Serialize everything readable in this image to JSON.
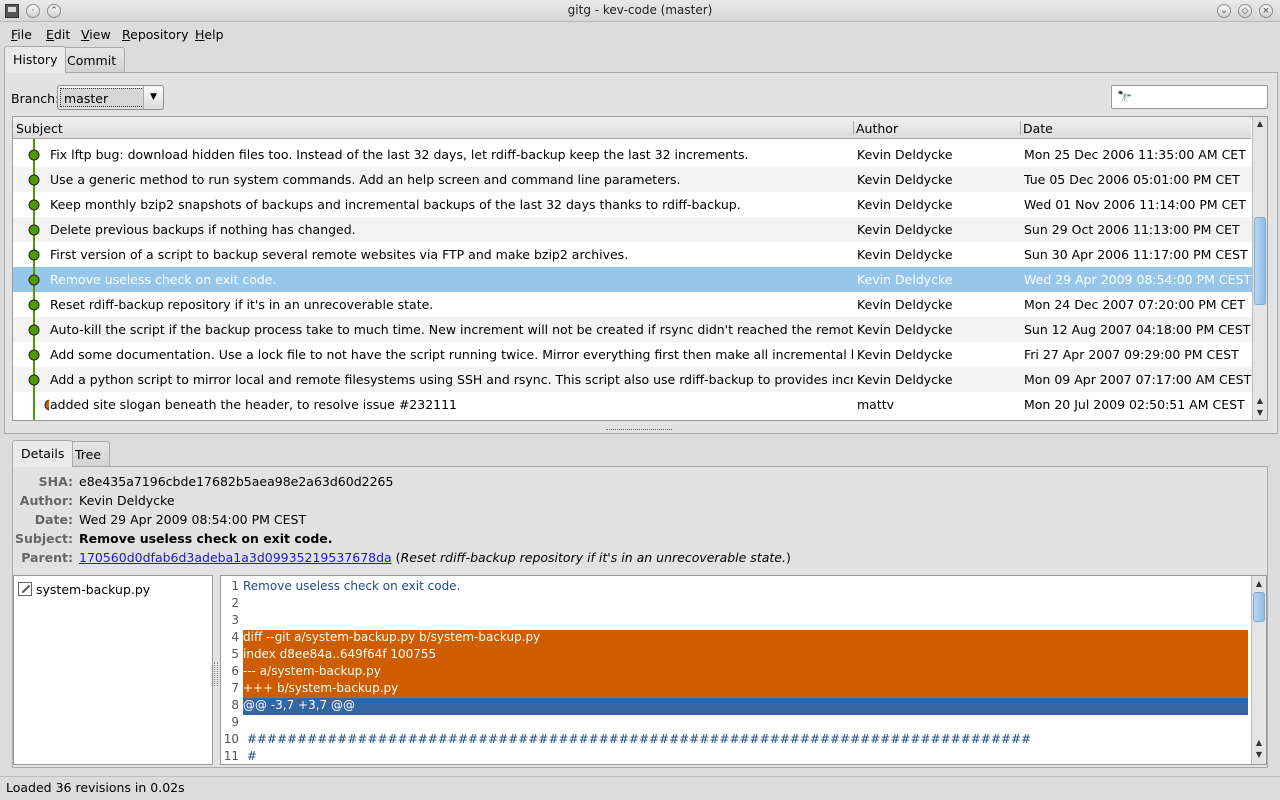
{
  "window": {
    "title": "gitg - kev-code (master)"
  },
  "menu": [
    {
      "label": "File",
      "u": "F",
      "rest": "ile"
    },
    {
      "label": "Edit",
      "u": "E",
      "rest": "dit"
    },
    {
      "label": "View",
      "u": "V",
      "rest": "iew"
    },
    {
      "label": "Repository",
      "u": "R",
      "rest": "epository"
    },
    {
      "label": "Help",
      "u": "H",
      "rest": "elp"
    }
  ],
  "tabs": {
    "history": "History",
    "commit": "Commit"
  },
  "branch": {
    "label": "Branch:",
    "value": "master"
  },
  "search": {
    "value": ""
  },
  "history": {
    "columns": {
      "subject": "Subject",
      "author": "Author",
      "date": "Date"
    },
    "rows": [
      {
        "subject": "Fix lftp bug: download hidden files too. Instead of the last 32 days, let rdiff-backup keep the last 32 increments.",
        "author": "Kevin Deldycke",
        "date": "Mon 25 Dec 2006 11:35:00 AM CET"
      },
      {
        "subject": "Use a generic method to run system commands. Add an help screen and command line parameters.",
        "author": "Kevin Deldycke",
        "date": "Tue 05 Dec 2006 05:01:00 PM CET"
      },
      {
        "subject": "Keep monthly bzip2 snapshots of backups and incremental backups of the last 32 days thanks to rdiff-backup.",
        "author": "Kevin Deldycke",
        "date": "Wed 01 Nov 2006 11:14:00 PM CET"
      },
      {
        "subject": "Delete previous backups if nothing has changed.",
        "author": "Kevin Deldycke",
        "date": "Sun 29 Oct 2006 11:13:00 PM CET"
      },
      {
        "subject": "First version of a script to backup several remote websites via FTP and make bzip2 archives.",
        "author": "Kevin Deldycke",
        "date": "Sun 30 Apr 2006 11:17:00 PM CEST"
      },
      {
        "subject": "Remove useless check on exit code.",
        "author": "Kevin Deldycke",
        "date": "Wed 29 Apr 2009 08:54:00 PM CEST"
      },
      {
        "subject": "Reset rdiff-backup repository if it's in an unrecoverable state.",
        "author": "Kevin Deldycke",
        "date": "Mon 24 Dec 2007 07:20:00 PM CET"
      },
      {
        "subject": "Auto-kill the script if the backup process take to much time. New increment will not be created if rsync didn't reached the remote host. Add some advice",
        "author": "Kevin Deldycke",
        "date": "Sun 12 Aug 2007 04:18:00 PM CEST"
      },
      {
        "subject": "Add some documentation. Use a lock file to not have the script running twice. Mirror everything first then make all incremental backups. Auto clean rdiff",
        "author": "Kevin Deldycke",
        "date": "Fri 27 Apr 2007 09:29:00 PM CEST"
      },
      {
        "subject": "Add a python script to mirror local and remote filesystems using SSH and rsync. This script also use rdiff-backup to provides incremental backups.",
        "author": "Kevin Deldycke",
        "date": "Mon 09 Apr 2007 07:17:00 AM CEST"
      },
      {
        "subject": "added site slogan beneath the header, to resolve issue #232111",
        "author": "mattv",
        "date": "Mon 20 Jul 2009 02:50:51 AM CEST"
      }
    ],
    "selected_index": 5,
    "graph_colors": {
      "green": "#4e9a06",
      "orange": "#ce5c00"
    }
  },
  "detail_tabs": {
    "details": "Details",
    "tree": "Tree"
  },
  "details": {
    "sha_label": "SHA:",
    "sha": "e8e435a7196cbde17682b5aea98e2a63d60d2265",
    "author_label": "Author:",
    "author": "Kevin Deldycke",
    "date_label": "Date:",
    "date": "Wed 29 Apr 2009 08:54:00 PM CEST",
    "subject_label": "Subject:",
    "subject": "Remove useless check on exit code.",
    "parent_label": "Parent:",
    "parent_sha": "170560d0dfab6d3adeba1a3d09935219537678da",
    "parent_note_open": " (",
    "parent_note": "Reset rdiff-backup repository if it's in an unrecoverable state.",
    "parent_note_close": ")"
  },
  "files": [
    {
      "name": "system-backup.py",
      "icon": "edit-file-icon"
    }
  ],
  "diff": [
    {
      "n": "1",
      "text": "Remove useless check on exit code.",
      "style": "blue"
    },
    {
      "n": "2",
      "text": "",
      "style": ""
    },
    {
      "n": "3",
      "text": "",
      "style": ""
    },
    {
      "n": "4",
      "text": "diff --git a/system-backup.py b/system-backup.py",
      "style": "hl"
    },
    {
      "n": "5",
      "text": "index d8ee84a..649f64f 100755",
      "style": "hl"
    },
    {
      "n": "6",
      "text": "--- a/system-backup.py",
      "style": "hl"
    },
    {
      "n": "7",
      "text": "+++ b/system-backup.py",
      "style": "hl"
    },
    {
      "n": "8",
      "text": "@@ -3,7 +3,7 @@",
      "style": "hunk"
    },
    {
      "n": "9",
      "text": "",
      "style": ""
    },
    {
      "n": "10",
      "text": " ##############################################################################",
      "style": "blue"
    },
    {
      "n": "11",
      "text": " #",
      "style": "blue"
    }
  ],
  "status": {
    "text": "Loaded 36 revisions in 0.02s"
  }
}
